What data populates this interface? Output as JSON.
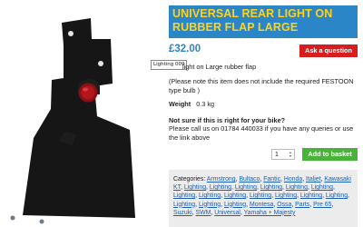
{
  "image": {
    "tooltip": "Lighting 009"
  },
  "product": {
    "title": "Universal Rear Light on Rubber Flap Large",
    "price": "£32.00",
    "ask_label": "Ask a question",
    "description": "light on Large rubber flap",
    "note": "(Please note this item does not include the required FESTOON type bulb )",
    "weight_label": "Weight",
    "weight_value": "0.3 kg",
    "help_heading": "Not sure if this is right for your bike?",
    "help_text": "Please call us on 01784 440033 if you have any queries or use the link above",
    "quantity": "1",
    "add_label": "Add to basket"
  },
  "categories": {
    "label": "Categories:",
    "links": [
      "Armstrong",
      "Bultaco",
      "Fantic",
      "Honda",
      "Italjet",
      "Kawasaki KT",
      "Lighting",
      "Lighting",
      "Lighting",
      "Lighting",
      "Lighting",
      "Lighting",
      "Lighting",
      "Lighting",
      "Lighting",
      "Lighting",
      "Lighting",
      "Lighting",
      "Lighting",
      "Lighting",
      "Lighting",
      "Lighting",
      "Montesa",
      "Ossa",
      "Parts",
      "Pre 65",
      "Suzuki",
      "SWM",
      "Universal",
      "Yamaha + Majesty"
    ]
  }
}
